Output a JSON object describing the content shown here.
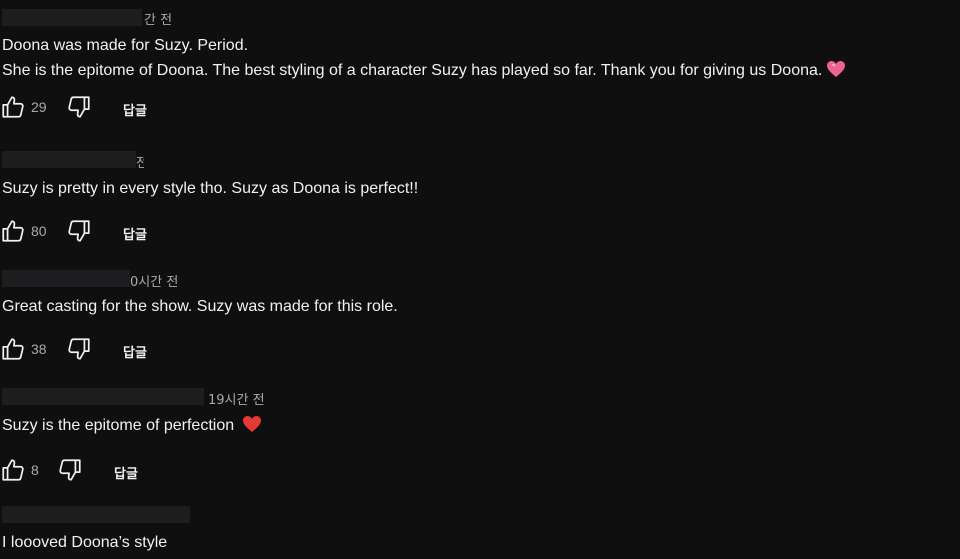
{
  "comments": [
    {
      "time": "간 전",
      "lines": [
        "Doona was made for Suzy. Period.",
        "She is the epitome of Doona. The best styling of a character Suzy has played so far. Thank you for giving us Doona."
      ],
      "emoji": "pink-heart",
      "likes": "29",
      "reply_label": "답글"
    },
    {
      "time": "전",
      "lines": [
        "Suzy is pretty in every style tho. Suzy as Doona is perfect!!"
      ],
      "likes": "80",
      "reply_label": "답글"
    },
    {
      "time": "0시간 전",
      "lines": [
        "Great casting for the show.  Suzy was made for this role."
      ],
      "likes": "38",
      "reply_label": "답글"
    },
    {
      "time": "19시간 전",
      "lines": [
        "Suzy is the epitome of perfection"
      ],
      "emoji": "red-heart",
      "likes": "8",
      "reply_label": "답글"
    },
    {
      "time": "",
      "lines": [
        "I loooved Doona’s style"
      ]
    }
  ],
  "colors": {
    "background": "#0f0f0f",
    "text": "#f1f1f1",
    "secondary": "#aaaaaa",
    "redaction": "#1d1d1f",
    "pink_heart": "#f06292",
    "red_heart": "#e53935"
  }
}
